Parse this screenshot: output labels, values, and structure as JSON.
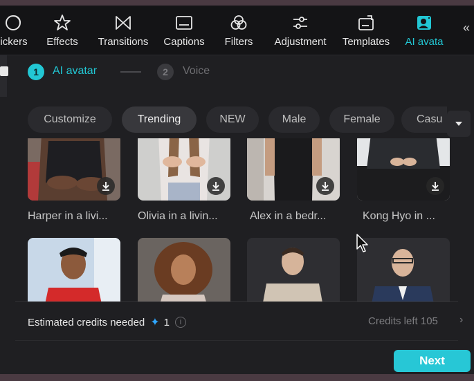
{
  "toolbar": {
    "items": [
      {
        "label": "ickers",
        "icon": "stickers-icon"
      },
      {
        "label": "Effects",
        "icon": "effects-star-icon"
      },
      {
        "label": "Transitions",
        "icon": "transitions-icon"
      },
      {
        "label": "Captions",
        "icon": "captions-icon"
      },
      {
        "label": "Filters",
        "icon": "filters-icon"
      },
      {
        "label": "Adjustment",
        "icon": "adjustment-sliders-icon"
      },
      {
        "label": "Templates",
        "icon": "templates-icon"
      },
      {
        "label": "AI avata",
        "icon": "ai-avatar-icon",
        "active": true
      }
    ],
    "collapse": "«"
  },
  "stepper": {
    "step1_num": "1",
    "step1_label": "AI avatar",
    "step2_num": "2",
    "step2_label": "Voice"
  },
  "chips": [
    {
      "label": "Customize"
    },
    {
      "label": "Trending",
      "active": true
    },
    {
      "label": "NEW"
    },
    {
      "label": "Male"
    },
    {
      "label": "Female"
    },
    {
      "label": "Casu"
    }
  ],
  "avatars_row1": [
    {
      "title": "Harper in a livi..."
    },
    {
      "title": "Olivia in a livin..."
    },
    {
      "title": "Alex in a bedr..."
    },
    {
      "title": "Kong Hyo in ..."
    }
  ],
  "footer": {
    "credits_label": "Estimated credits needed",
    "credits_icon": "✦",
    "credits_value": "1",
    "info_icon": "i",
    "credits_left": "Credits left 105",
    "chevron": "›",
    "next_label": "Next"
  },
  "colors": {
    "accent": "#22c7d4",
    "panel": "#1f1f22",
    "toolbar": "#141416",
    "next_button": "#27c7d6"
  }
}
